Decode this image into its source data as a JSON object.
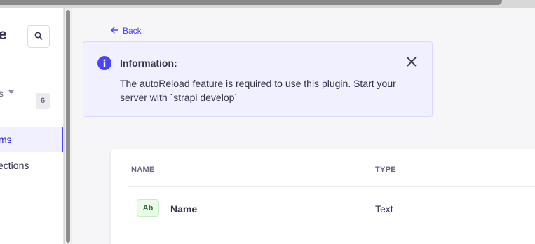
{
  "sidebar": {
    "brand_letter": "e",
    "section_label": "s",
    "section_count": "6",
    "items": [
      {
        "label": "ms",
        "active": true
      },
      {
        "label": "ections",
        "active": false
      }
    ]
  },
  "main": {
    "back_label": "Back",
    "alert": {
      "title": "Information:",
      "message": "The autoReload feature is required to use this plugin. Start your server with `strapi develop`"
    },
    "table": {
      "headers": {
        "name": "NAME",
        "type": "TYPE"
      },
      "rows": [
        {
          "badge": "Ab",
          "name": "Name",
          "type": "Text"
        }
      ]
    }
  },
  "colors": {
    "accent": "#4945ff",
    "alert_bg": "#f0f0ff",
    "badge_bg": "#eafbe7",
    "badge_text": "#2f6846"
  }
}
